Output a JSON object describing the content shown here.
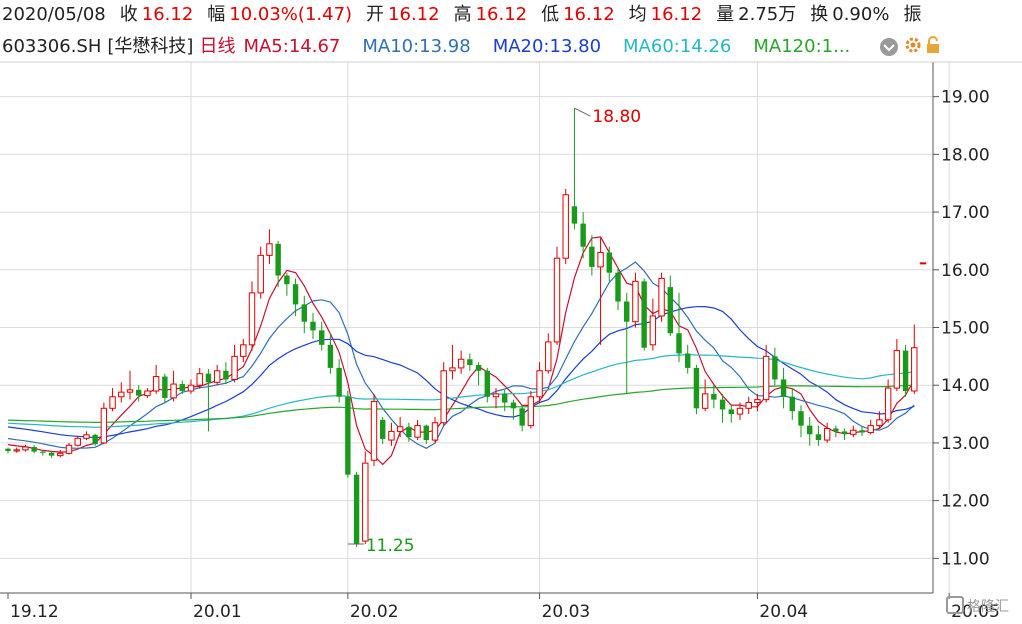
{
  "header": {
    "date": "2020/05/08",
    "close_label": "收",
    "close_value": "16.12",
    "change_label": "幅",
    "change_value": "10.03%(1.47)",
    "open_label": "开",
    "open_value": "16.12",
    "high_label": "高",
    "high_value": "16.12",
    "low_label": "低",
    "low_value": "16.12",
    "avg_label": "均",
    "avg_value": "16.12",
    "volume_label": "量",
    "volume_value": "2.75万",
    "turnover_label": "换",
    "turnover_value": "0.90%",
    "amplitude_label": "振"
  },
  "legend": {
    "code": "603306.SH",
    "name": "[华懋科技]",
    "period": "日线",
    "ma5": "MA5:14.67",
    "ma10": "MA10:13.98",
    "ma20": "MA20:13.80",
    "ma60": "MA60:14.26",
    "ma120": "MA120:1..."
  },
  "toolbar": {
    "dropdown_icon": "chevron-down-icon",
    "settings_icon": "gear-icon",
    "lock_icon": "lock-icon"
  },
  "watermark": "格隆汇",
  "colors": {
    "up": "#e00000",
    "down": "#1a9a1a",
    "ma5": "#c8102e",
    "ma10": "#2f6fb5",
    "ma20": "#1a3fd0",
    "ma60": "#25b8c8",
    "ma120": "#2aa52a",
    "grid": "#dcdcdc"
  },
  "chart_data": {
    "type": "candlestick",
    "y_ticks": [
      "19.00",
      "18.00",
      "17.00",
      "16.00",
      "15.00",
      "14.00",
      "13.00",
      "12.00",
      "11.00"
    ],
    "ylim": [
      10.4,
      19.6
    ],
    "x_ticks": [
      {
        "label": "19.12",
        "index": 0
      },
      {
        "label": "20.01",
        "index": 21
      },
      {
        "label": "20.02",
        "index": 39
      },
      {
        "label": "20.03",
        "index": 61
      },
      {
        "label": "20.04",
        "index": 86
      },
      {
        "label": "20.05",
        "index": 108
      }
    ],
    "annotations": [
      {
        "text": "18.80",
        "index": 65,
        "price": 18.8,
        "color": "#e00000"
      },
      {
        "text": "11.25",
        "index": 39,
        "price": 11.25,
        "color": "#1a9a1a"
      }
    ],
    "candles": [
      [
        12.9,
        12.86,
        12.92,
        12.82
      ],
      [
        12.86,
        12.88,
        12.92,
        12.83
      ],
      [
        12.88,
        12.93,
        12.97,
        12.85
      ],
      [
        12.93,
        12.85,
        12.96,
        12.82
      ],
      [
        12.85,
        12.83,
        12.88,
        12.78
      ],
      [
        12.83,
        12.78,
        12.86,
        12.74
      ],
      [
        12.78,
        12.82,
        12.88,
        12.75
      ],
      [
        12.82,
        12.96,
        13.0,
        12.8
      ],
      [
        12.96,
        13.08,
        13.12,
        12.94
      ],
      [
        13.08,
        13.14,
        13.2,
        13.05
      ],
      [
        13.14,
        12.98,
        13.16,
        12.95
      ],
      [
        13.0,
        13.6,
        13.7,
        12.98
      ],
      [
        13.6,
        13.8,
        13.95,
        13.55
      ],
      [
        13.8,
        13.88,
        14.05,
        13.7
      ],
      [
        13.88,
        13.92,
        14.25,
        13.75
      ],
      [
        13.92,
        13.82,
        14.0,
        13.72
      ],
      [
        13.82,
        13.9,
        13.95,
        13.78
      ],
      [
        13.9,
        14.15,
        14.35,
        13.85
      ],
      [
        14.15,
        13.78,
        14.2,
        13.7
      ],
      [
        13.78,
        14.02,
        14.25,
        13.72
      ],
      [
        14.02,
        13.9,
        14.08,
        13.85
      ],
      [
        13.9,
        14.0,
        14.1,
        13.85
      ],
      [
        14.0,
        14.2,
        14.3,
        13.94
      ],
      [
        14.2,
        14.05,
        14.28,
        13.2
      ],
      [
        14.05,
        14.25,
        14.35,
        14.0
      ],
      [
        14.25,
        14.1,
        14.4,
        14.02
      ],
      [
        14.1,
        14.5,
        14.7,
        14.05
      ],
      [
        14.5,
        14.7,
        14.8,
        14.4
      ],
      [
        14.7,
        15.6,
        15.8,
        14.6
      ],
      [
        15.6,
        16.25,
        16.4,
        15.5
      ],
      [
        16.25,
        16.45,
        16.7,
        16.1
      ],
      [
        16.45,
        15.9,
        16.5,
        15.7
      ],
      [
        15.9,
        15.75,
        15.95,
        15.55
      ],
      [
        15.75,
        15.4,
        15.85,
        15.2
      ],
      [
        15.4,
        15.1,
        15.55,
        14.9
      ],
      [
        15.1,
        14.95,
        15.25,
        14.8
      ],
      [
        14.95,
        14.7,
        15.1,
        14.6
      ],
      [
        14.7,
        14.3,
        14.9,
        14.2
      ],
      [
        14.3,
        13.8,
        14.45,
        13.7
      ],
      [
        13.8,
        12.45,
        13.9,
        12.4
      ],
      [
        12.45,
        11.25,
        12.5,
        11.2
      ],
      [
        11.3,
        12.65,
        12.85,
        11.25
      ],
      [
        12.7,
        13.72,
        13.85,
        12.6
      ],
      [
        13.4,
        13.07,
        13.45,
        12.98
      ],
      [
        13.05,
        13.2,
        13.35,
        12.95
      ],
      [
        13.2,
        13.28,
        13.45,
        13.1
      ],
      [
        13.28,
        13.1,
        13.35,
        13.02
      ],
      [
        13.1,
        13.3,
        13.4,
        13.05
      ],
      [
        13.3,
        13.05,
        13.32,
        12.98
      ],
      [
        13.05,
        13.35,
        13.45,
        13.0
      ],
      [
        13.35,
        14.25,
        14.4,
        13.3
      ],
      [
        14.25,
        14.3,
        14.7,
        14.1
      ],
      [
        14.3,
        14.45,
        14.6,
        14.2
      ],
      [
        14.45,
        14.35,
        14.55,
        14.25
      ],
      [
        14.35,
        14.25,
        14.4,
        14.0
      ],
      [
        14.25,
        13.8,
        14.3,
        13.7
      ],
      [
        13.8,
        13.85,
        13.95,
        13.6
      ],
      [
        13.85,
        13.7,
        13.92,
        13.55
      ],
      [
        13.7,
        13.6,
        13.75,
        13.4
      ],
      [
        13.6,
        13.3,
        13.65,
        13.2
      ],
      [
        13.3,
        13.8,
        13.9,
        13.25
      ],
      [
        13.8,
        14.25,
        14.4,
        13.7
      ],
      [
        14.25,
        14.75,
        14.9,
        14.2
      ],
      [
        14.75,
        16.2,
        16.4,
        14.7
      ],
      [
        16.2,
        17.3,
        17.4,
        16.1
      ],
      [
        17.1,
        16.8,
        18.8,
        16.7
      ],
      [
        16.8,
        16.4,
        17.0,
        16.2
      ],
      [
        16.4,
        16.05,
        16.6,
        15.9
      ],
      [
        16.05,
        16.3,
        16.55,
        14.7
      ],
      [
        16.3,
        15.95,
        16.4,
        15.8
      ],
      [
        15.95,
        15.45,
        16.05,
        15.3
      ],
      [
        15.45,
        15.1,
        15.6,
        13.85
      ],
      [
        15.1,
        15.8,
        15.95,
        15.0
      ],
      [
        15.8,
        14.65,
        15.85,
        14.6
      ],
      [
        14.7,
        15.2,
        15.5,
        14.6
      ],
      [
        15.2,
        15.85,
        15.95,
        15.1
      ],
      [
        15.7,
        14.9,
        15.9,
        14.85
      ],
      [
        14.9,
        14.55,
        15.6,
        14.4
      ],
      [
        14.55,
        14.3,
        14.7,
        14.2
      ],
      [
        14.3,
        13.6,
        14.35,
        13.5
      ],
      [
        13.6,
        13.85,
        14.1,
        13.55
      ],
      [
        13.85,
        13.75,
        14.0,
        13.6
      ],
      [
        13.75,
        13.58,
        13.85,
        13.35
      ],
      [
        13.58,
        13.5,
        13.65,
        13.35
      ],
      [
        13.5,
        13.6,
        13.7,
        13.4
      ],
      [
        13.6,
        13.7,
        13.8,
        13.5
      ],
      [
        13.7,
        13.75,
        13.85,
        13.55
      ],
      [
        13.75,
        14.5,
        14.7,
        13.7
      ],
      [
        14.5,
        14.1,
        14.65,
        14.0
      ],
      [
        14.1,
        13.8,
        14.3,
        13.6
      ],
      [
        13.8,
        13.55,
        13.95,
        13.4
      ],
      [
        13.55,
        13.3,
        13.65,
        13.1
      ],
      [
        13.3,
        13.15,
        13.45,
        12.95
      ],
      [
        13.15,
        13.05,
        13.3,
        12.95
      ],
      [
        13.05,
        13.25,
        13.35,
        13.0
      ],
      [
        13.25,
        13.2,
        13.3,
        13.1
      ],
      [
        13.2,
        13.15,
        13.25,
        13.05
      ],
      [
        13.15,
        13.22,
        13.3,
        13.1
      ],
      [
        13.22,
        13.18,
        13.28,
        13.12
      ],
      [
        13.18,
        13.3,
        13.4,
        13.15
      ],
      [
        13.3,
        13.4,
        13.55,
        13.25
      ],
      [
        13.4,
        13.95,
        14.1,
        13.35
      ],
      [
        13.95,
        14.6,
        14.8,
        13.9
      ],
      [
        14.6,
        13.9,
        14.7,
        13.8
      ],
      [
        13.9,
        14.65,
        15.05,
        13.85
      ],
      [
        16.12,
        16.12,
        16.12,
        16.12
      ]
    ]
  }
}
